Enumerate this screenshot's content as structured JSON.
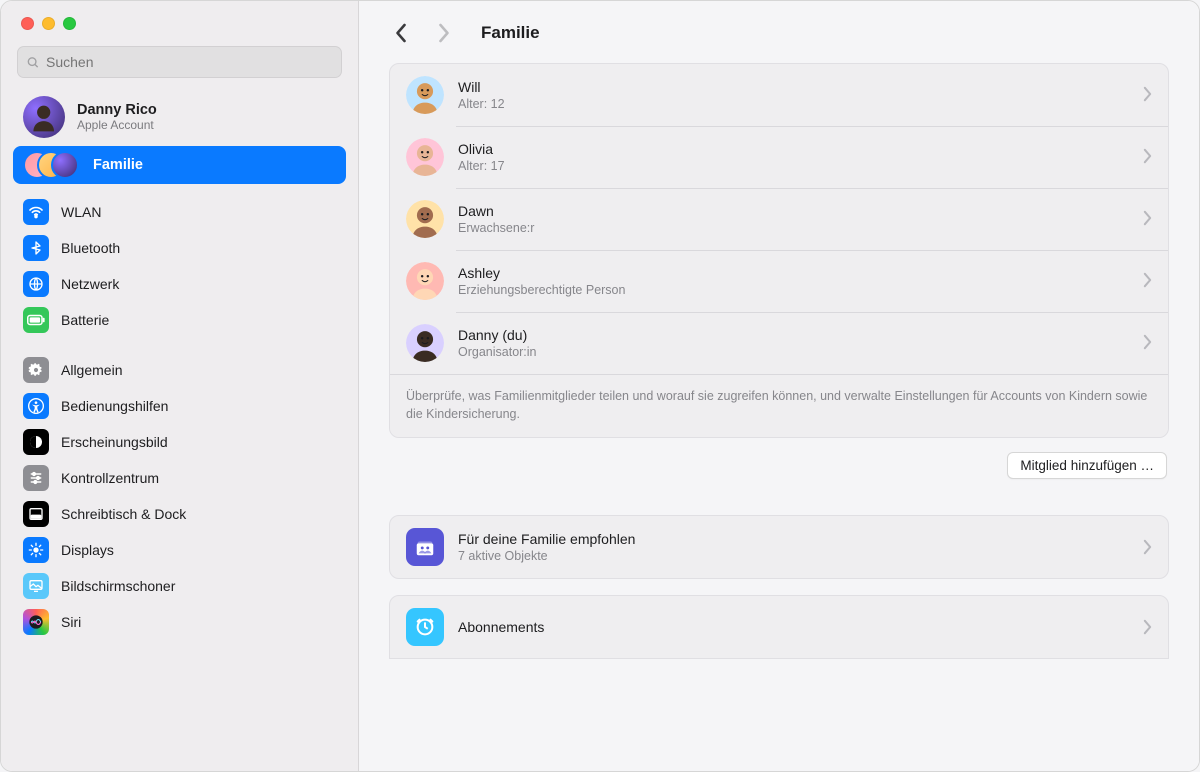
{
  "search": {
    "placeholder": "Suchen"
  },
  "account": {
    "name": "Danny Rico",
    "sub": "Apple Account"
  },
  "family_nav": {
    "label": "Familie"
  },
  "sidebar": {
    "items": [
      {
        "label": "WLAN",
        "icon": "wifi",
        "color": "ic-blue"
      },
      {
        "label": "Bluetooth",
        "icon": "bluetooth",
        "color": "ic-blue"
      },
      {
        "label": "Netzwerk",
        "icon": "globe",
        "color": "ic-blue"
      },
      {
        "label": "Batterie",
        "icon": "battery",
        "color": "ic-green"
      }
    ],
    "items2": [
      {
        "label": "Allgemein",
        "icon": "gear",
        "color": "ic-gray"
      },
      {
        "label": "Bedienungshilfen",
        "icon": "access",
        "color": "ic-blue"
      },
      {
        "label": "Erscheinungsbild",
        "icon": "appearance",
        "color": "ic-black"
      },
      {
        "label": "Kontrollzentrum",
        "icon": "sliders",
        "color": "ic-gray"
      },
      {
        "label": "Schreibtisch & Dock",
        "icon": "dock",
        "color": "ic-black"
      },
      {
        "label": "Displays",
        "icon": "display",
        "color": "ic-blue"
      },
      {
        "label": "Bildschirmschoner",
        "icon": "screensaver",
        "color": "ic-lightblue"
      },
      {
        "label": "Siri",
        "icon": "siri",
        "color": "ic-gradient"
      }
    ]
  },
  "header": {
    "title": "Familie"
  },
  "members": [
    {
      "name": "Will",
      "sub": "Alter: 12",
      "avatarBg": "#bfe4ff",
      "face": "#d89a5a"
    },
    {
      "name": "Olivia",
      "sub": "Alter: 17",
      "avatarBg": "#ffc5d8",
      "face": "#e8b596"
    },
    {
      "name": "Dawn",
      "sub": "Erwachsene:r",
      "avatarBg": "#ffe2a8",
      "face": "#a16c4f"
    },
    {
      "name": "Ashley",
      "sub": "Erziehungsberechtigte Person",
      "avatarBg": "#ffb9b3",
      "face": "#ffd7b5"
    },
    {
      "name": "Danny (du)",
      "sub": "Organisator:in",
      "avatarBg": "#d9d0ff",
      "face": "#3a2c23"
    }
  ],
  "members_footer": "Überprüfe, was Familienmitglieder teilen und worauf sie zugreifen können, und verwalte Einstellungen für Accounts von Kindern sowie die Kindersicherung.",
  "add_member_button": "Mitglied hinzufügen …",
  "recommended": {
    "title": "Für deine Familie empfohlen",
    "sub": "7 aktive Objekte"
  },
  "subscriptions": {
    "title": "Abonnements"
  }
}
